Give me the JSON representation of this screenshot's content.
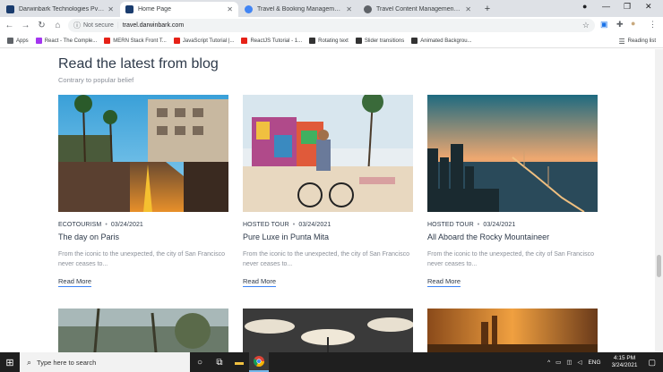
{
  "browser": {
    "tabs": [
      {
        "title": "Darwinbark Technologies Pvt. Ltd",
        "active": false,
        "favicon_color": "#1a3c6e"
      },
      {
        "title": "Home Page",
        "active": true,
        "favicon_color": "#1a3c6e"
      },
      {
        "title": "Travel & Booking Management S",
        "active": false,
        "favicon_color": "#4285f4"
      },
      {
        "title": "Travel Content Management Syst",
        "active": false,
        "favicon_color": "#5f6368"
      }
    ],
    "new_tab": "+",
    "address": {
      "security": "Not secure",
      "url": "travel.darwinbark.com"
    },
    "bookmarks": [
      {
        "label": "Apps",
        "color": "#5f6368"
      },
      {
        "label": "React - The Comple...",
        "color": "#a435f0"
      },
      {
        "label": "MERN Stack Front T...",
        "color": "#e62117"
      },
      {
        "label": "JavaScript Tutorial |...",
        "color": "#e62117"
      },
      {
        "label": "ReactJS Tutorial - 1...",
        "color": "#e62117"
      },
      {
        "label": "Rotating text",
        "color": "#333333"
      },
      {
        "label": "Slider transitions",
        "color": "#333333"
      },
      {
        "label": "Animated Backgrou...",
        "color": "#333333"
      }
    ],
    "reading_list": "Reading list"
  },
  "page": {
    "heading": "Read the latest from blog",
    "subheading": "Contrary to popular belief",
    "posts": [
      {
        "category": "ECOTOURISM",
        "date": "03/24/2021",
        "title": "The day on Paris",
        "excerpt": "From the iconic to the unexpected, the city of San Francisco never ceases to...",
        "link": "Read More"
      },
      {
        "category": "HOSTED TOUR",
        "date": "03/24/2021",
        "title": "Pure Luxe in Punta Mita",
        "excerpt": "From the iconic to the unexpected, the city of San Francisco never ceases to...",
        "link": "Read More"
      },
      {
        "category": "HOSTED TOUR",
        "date": "03/24/2021",
        "title": "All Aboard the Rocky Mountaineer",
        "excerpt": "From the iconic to the unexpected, the city of San Francisco never ceases to...",
        "link": "Read More"
      }
    ]
  },
  "taskbar": {
    "search_placeholder": "Type here to search",
    "language": "ENG",
    "time": "4:15 PM",
    "date": "3/24/2021"
  }
}
